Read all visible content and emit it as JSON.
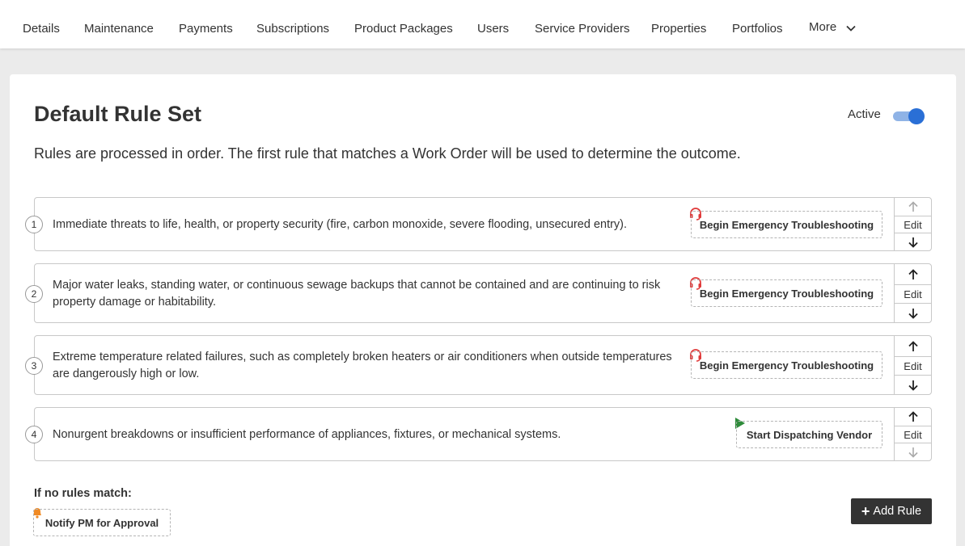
{
  "nav": {
    "items": [
      {
        "label": "Details"
      },
      {
        "label": "Maintenance"
      },
      {
        "label": "Payments"
      },
      {
        "label": "Subscriptions"
      },
      {
        "label": "Product Packages"
      },
      {
        "label": "Users"
      },
      {
        "label": "Service Providers"
      },
      {
        "label": "Properties"
      },
      {
        "label": "Portfolios"
      }
    ],
    "more_label": "More",
    "more_icon": "chevron-down-icon"
  },
  "ruleset": {
    "title": "Default Rule Set",
    "active_label": "Active",
    "active": true,
    "description": "Rules are processed in order. The first rule that matches a Work Order will be used to determine the outcome."
  },
  "rules": [
    {
      "number": "1",
      "text": "Immediate threats to life, health, or property security (fire, carbon monoxide, severe flooding, unsecured entry).",
      "action": "Begin Emergency Troubleshooting",
      "action_icon": "headset-icon",
      "edit_label": "Edit",
      "up_enabled": false,
      "down_enabled": true
    },
    {
      "number": "2",
      "text": "Major water leaks, standing water, or continuous sewage backups that cannot be contained and are continuing to risk property damage or habitability.",
      "action": "Begin Emergency Troubleshooting",
      "action_icon": "headset-icon",
      "edit_label": "Edit",
      "up_enabled": true,
      "down_enabled": true
    },
    {
      "number": "3",
      "text": "Extreme temperature related failures, such as completely broken heaters or air conditioners when outside temperatures are dangerously high or low.",
      "action": "Begin Emergency Troubleshooting",
      "action_icon": "headset-icon",
      "edit_label": "Edit",
      "up_enabled": true,
      "down_enabled": true
    },
    {
      "number": "4",
      "text": "Nonurgent breakdowns or insufficient performance of appliances, fixtures, or mechanical systems.",
      "action": "Start Dispatching Vendor",
      "action_icon": "play-icon",
      "edit_label": "Edit",
      "up_enabled": true,
      "down_enabled": false
    }
  ],
  "fallback": {
    "title": "If no rules match:",
    "action": "Notify PM for Approval",
    "action_icon": "bell-icon"
  },
  "add_rule_label": "Add Rule",
  "colors": {
    "accent": "#2a6fd6",
    "emergency": "#e03a3a",
    "dispatch": "#2e8b3a",
    "notify": "#f08a24",
    "dark_button": "#333333"
  }
}
